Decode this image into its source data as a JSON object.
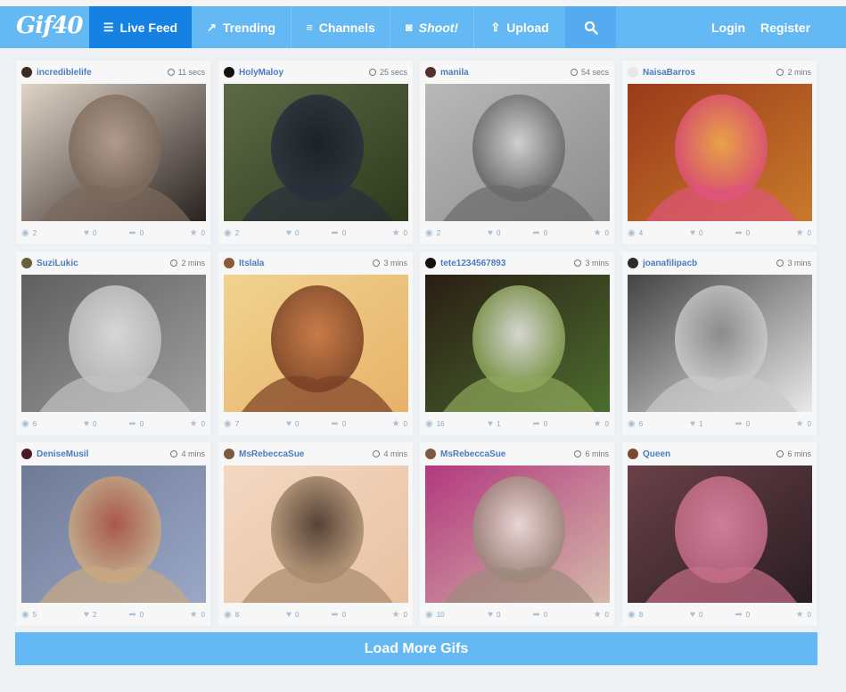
{
  "brand": {
    "logo_text": "Gif40"
  },
  "nav": {
    "live_feed": "Live Feed",
    "trending": "Trending",
    "channels": "Channels",
    "shoot": "Shoot!",
    "upload": "Upload",
    "login": "Login",
    "register": "Register"
  },
  "colors": {
    "header": "#64b9f5",
    "active_tab": "#1481e3",
    "username": "#4a7cc0"
  },
  "gifs": [
    {
      "user": "incrediblelife",
      "time": "11 secs",
      "views": "2",
      "likes": "0",
      "shares": "0",
      "favs": "0",
      "avatar": "#3a2a22",
      "tones": [
        "#2a2220",
        "#b59f8e",
        "#e0d4c8",
        "#7d6a5c"
      ]
    },
    {
      "user": "HolyMaloy",
      "time": "25 secs",
      "views": "2",
      "likes": "0",
      "shares": "0",
      "favs": "0",
      "avatar": "#111111",
      "tones": [
        "#2f3a1c",
        "#141923",
        "#5c6b47",
        "#2a2e3c"
      ]
    },
    {
      "user": "manila",
      "time": "54 secs",
      "views": "2",
      "likes": "0",
      "shares": "0",
      "favs": "0",
      "avatar": "#55302a",
      "tones": [
        "#8d8d8d",
        "#d7d7d7",
        "#b8b8b8",
        "#6a6a6a"
      ]
    },
    {
      "user": "NaisaBarros",
      "time": "2 mins",
      "views": "4",
      "likes": "0",
      "shares": "0",
      "favs": "0",
      "avatar": "#e8e8e8",
      "tones": [
        "#c87a2b",
        "#f1b04c",
        "#9b3a1a",
        "#e0547a"
      ]
    },
    {
      "user": "SuziLukic",
      "time": "2 mins",
      "views": "6",
      "likes": "0",
      "shares": "0",
      "favs": "0",
      "avatar": "#6b5e3e",
      "tones": [
        "#9f9f9f",
        "#e6e6e6",
        "#5f5f5f",
        "#c2c2c2"
      ]
    },
    {
      "user": "Itslala",
      "time": "3 mins",
      "views": "7",
      "likes": "0",
      "shares": "0",
      "favs": "0",
      "avatar": "#8a5a3a",
      "tones": [
        "#e7b26a",
        "#c46e3e",
        "#f0d38e",
        "#7a3f23"
      ]
    },
    {
      "user": "tete1234567893",
      "time": "3 mins",
      "views": "16",
      "likes": "1",
      "shares": "0",
      "favs": "0",
      "avatar": "#111111",
      "tones": [
        "#4b6d2e",
        "#f0f0f0",
        "#2a1d14",
        "#8ea65b"
      ]
    },
    {
      "user": "joanafilipacb",
      "time": "3 mins",
      "views": "6",
      "likes": "1",
      "shares": "0",
      "favs": "0",
      "avatar": "#2b2b2b",
      "tones": [
        "#e9e9e9",
        "#8a8a8a",
        "#444444",
        "#c9c9c9"
      ]
    },
    {
      "user": "DeniseMusil",
      "time": "4 mins",
      "views": "5",
      "likes": "2",
      "shares": "0",
      "favs": "0",
      "avatar": "#4a1a2a",
      "tones": [
        "#9aa7c7",
        "#b04e3a",
        "#6f7a96",
        "#c9a880"
      ]
    },
    {
      "user": "MsRebeccaSue",
      "time": "4 mins",
      "views": "8",
      "likes": "0",
      "shares": "0",
      "favs": "0",
      "avatar": "#7a5a40",
      "tones": [
        "#e8c1a2",
        "#3a2a22",
        "#f4d8c2",
        "#a88a6c"
      ]
    },
    {
      "user": "MsRebeccaSue",
      "time": "6 mins",
      "views": "10",
      "likes": "0",
      "shares": "0",
      "favs": "0",
      "avatar": "#7a5a40",
      "tones": [
        "#d4b8a8",
        "#f0e6e0",
        "#b3387f",
        "#9c8a7c"
      ]
    },
    {
      "user": "Queen",
      "time": "6 mins",
      "views": "8",
      "likes": "0",
      "shares": "0",
      "favs": "0",
      "avatar": "#7a4a30",
      "tones": [
        "#2a1e22",
        "#e58aa8",
        "#6a4048",
        "#c76d8a"
      ]
    }
  ],
  "load_more": "Load More Gifs"
}
